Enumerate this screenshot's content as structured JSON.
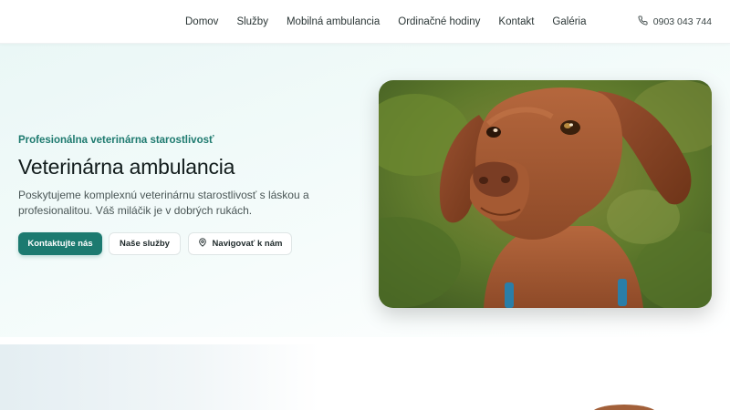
{
  "nav": {
    "items": [
      {
        "label": "Domov"
      },
      {
        "label": "Služby"
      },
      {
        "label": "Mobilná ambulancia"
      },
      {
        "label": "Ordinačné hodiny"
      },
      {
        "label": "Kontakt"
      },
      {
        "label": "Galéria"
      }
    ],
    "phone": "0903 043 744",
    "phone_icon": "phone-icon"
  },
  "hero": {
    "tagline": "Profesionálna veterinárna starostlivosť",
    "title": "Veterinárna ambulancia",
    "description": "Poskytujeme komplexnú veterinárnu starostlivosť s láskou a profesionalitou. Váš miláčik je v dobrých rukách.",
    "buttons": {
      "contact": "Kontaktujte nás",
      "services": "Naše služby",
      "navigate": "Navigovať k nám",
      "navigate_icon": "map-pin-icon"
    },
    "image_subject": "dog-photo"
  },
  "colors": {
    "accent": "#1c7a70",
    "tagline": "#1e7a6f",
    "hero_bg": "#eaf7f6"
  }
}
